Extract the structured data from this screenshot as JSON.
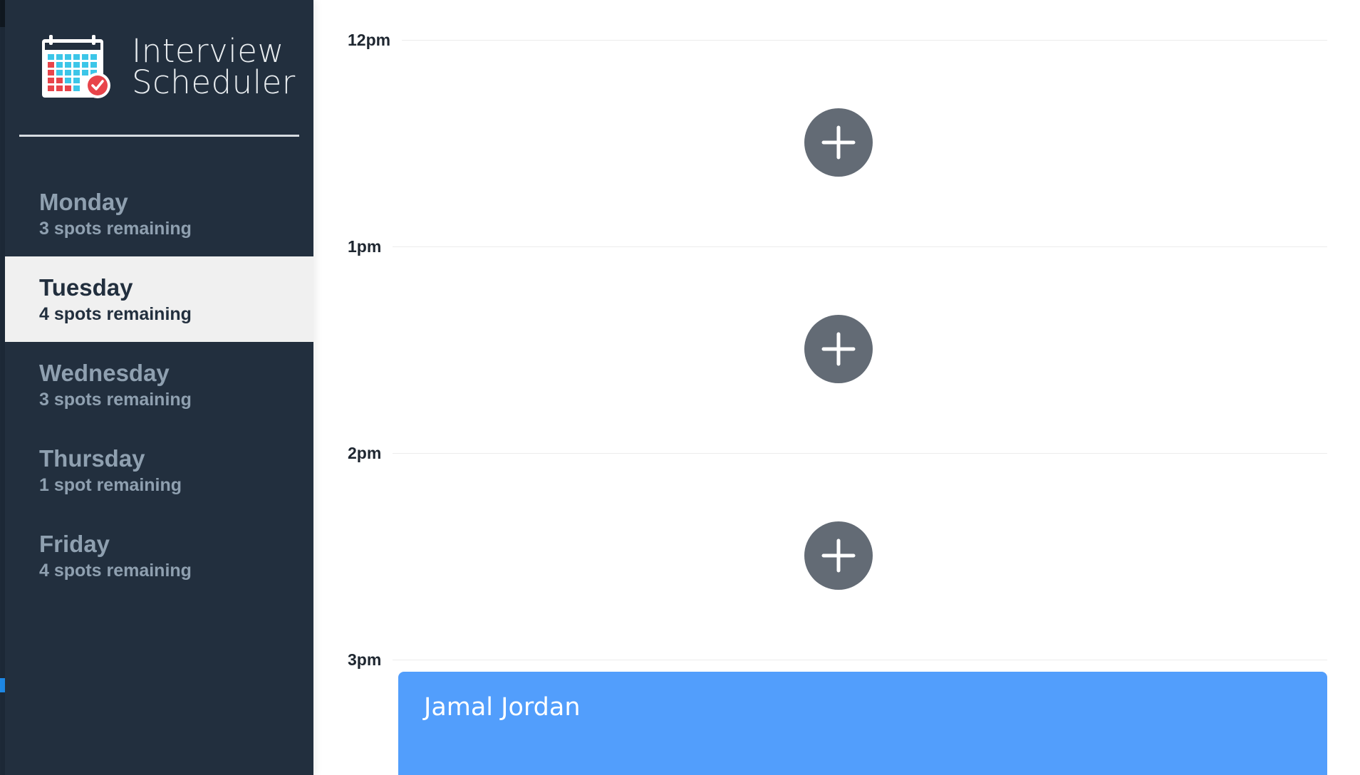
{
  "app": {
    "title_line1": "Interview",
    "title_line2": "Scheduler",
    "logo_icon": "calendar-check-icon"
  },
  "days": [
    {
      "name": "Monday",
      "spots": "3 spots remaining",
      "selected": false
    },
    {
      "name": "Tuesday",
      "spots": "4 spots remaining",
      "selected": true
    },
    {
      "name": "Wednesday",
      "spots": "3 spots remaining",
      "selected": false
    },
    {
      "name": "Thursday",
      "spots": "1 spot remaining",
      "selected": false
    },
    {
      "name": "Friday",
      "spots": "4 spots remaining",
      "selected": false
    }
  ],
  "schedule": {
    "hours": [
      "12pm",
      "1pm",
      "2pm",
      "3pm"
    ],
    "add_button_icon": "plus-icon",
    "appointment": {
      "student": "Jamal Jordan"
    }
  },
  "colors": {
    "sidebar_bg": "#222f3e",
    "selected_bg": "#f0f0f0",
    "muted_text": "#8fa0b0",
    "add_button": "#636b75",
    "appointment_bg": "#529efc",
    "logo_red": "#e8444a",
    "logo_teal": "#3cc6e8"
  }
}
